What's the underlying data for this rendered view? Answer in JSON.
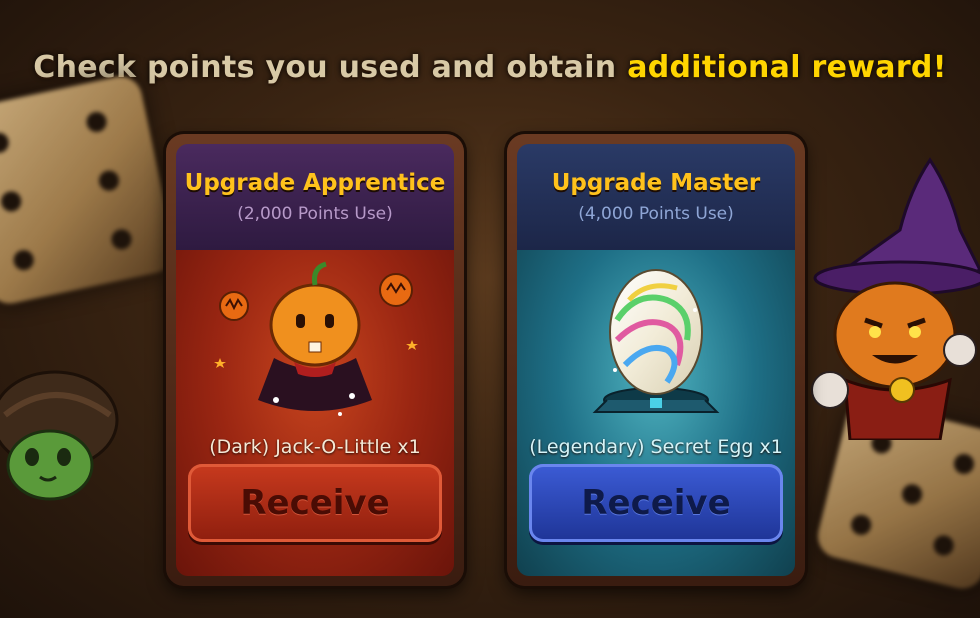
{
  "headline": {
    "text": "Check points you used and obtain ",
    "highlight": "additional reward!"
  },
  "cards": [
    {
      "title": "Upgrade Apprentice",
      "points": "(2,000 Points Use)",
      "item": "(Dark) Jack-O-Little x1",
      "button": "Receive",
      "theme_color": "#9a2612",
      "item_icon": "pumpkin-character-icon"
    },
    {
      "title": "Upgrade Master",
      "points": "(4,000 Points Use)",
      "item": "(Legendary) Secret Egg x1",
      "button": "Receive",
      "theme_color": "#1e6f86",
      "item_icon": "rainbow-egg-icon"
    }
  ],
  "colors": {
    "title_gold": "#ffc21c",
    "highlight_yellow": "#ffd500"
  }
}
